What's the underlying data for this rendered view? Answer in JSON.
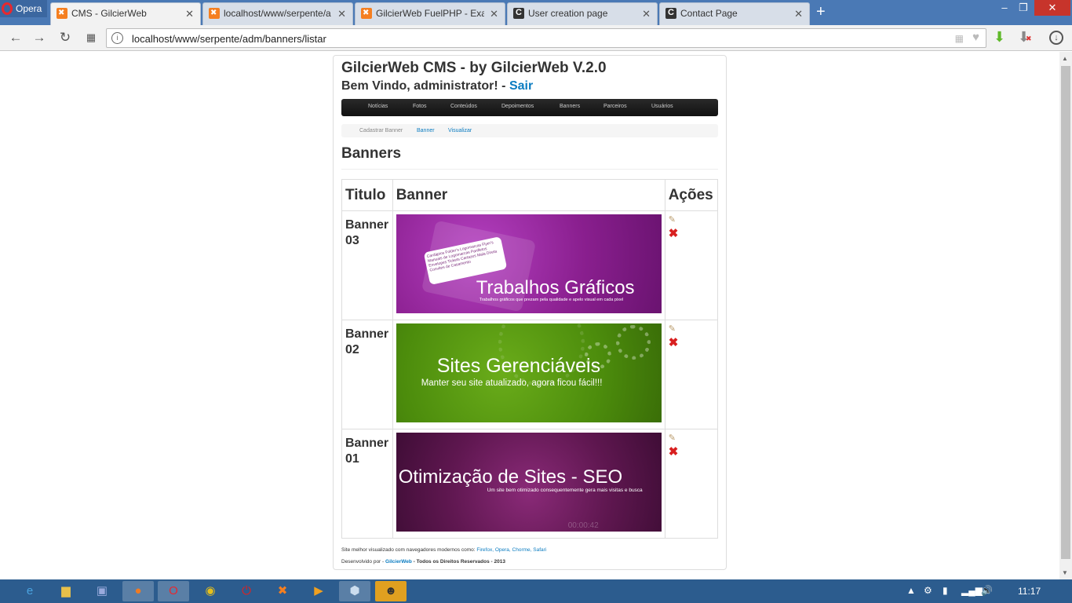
{
  "browser": {
    "menu_label": "Opera",
    "tabs": [
      {
        "label": "CMS - GilcierWeb",
        "icon": "xampp-icon",
        "active": true
      },
      {
        "label": "localhost/www/serpente/a",
        "icon": "xampp-icon",
        "active": false
      },
      {
        "label": "GilcierWeb FuelPHP - Exam",
        "icon": "xampp-icon",
        "active": false
      },
      {
        "label": "User creation page",
        "icon": "c-icon",
        "active": false
      },
      {
        "label": "Contact Page",
        "icon": "c-icon",
        "active": false
      }
    ],
    "address": "localhost/www/serpente/adm/banners/listar"
  },
  "page": {
    "site_title": "GilcierWeb CMS - by GilcierWeb V.2.0",
    "welcome_prefix": "Bem Vindo, administrator! -",
    "logout_label": "Sair",
    "nav": [
      "Notícias",
      "Fotos",
      "Conteúdos",
      "Depoimentos",
      "Banners",
      "Parceiros",
      "Usuários"
    ],
    "subnav": [
      "Cadastrar Banner",
      "Banner",
      "Visualizar"
    ],
    "heading": "Banners",
    "table": {
      "headers": [
        "Titulo",
        "Banner",
        "Ações"
      ],
      "rows": [
        {
          "title": "Banner 03",
          "banner_text": "Trabalhos Gráficos",
          "banner_sub": "Trabalhos gráficos que prezam pela qualidade e apelo visual em cada pixel",
          "bubble_text": "Cardápios  Folder's  Logomarcas  Flyer's  Manuais de Logomarcas  Panfletos  Envelopes  Tickets  Cartazes  Mala Direta  Convites de Casamento"
        },
        {
          "title": "Banner 02",
          "banner_text": "Sites Gerenciáveis",
          "banner_sub": "Manter seu site atualizado, agora ficou fácil!!!"
        },
        {
          "title": "Banner 01",
          "banner_text": "Otimização de Sites - SEO",
          "banner_sub": "Um site bem otimizado consequentemente gera mais visitas e busca",
          "watermark": "00:00:42"
        }
      ]
    },
    "footer": {
      "line1_prefix": "Site melhor visualizado com navegadores modernos como:",
      "browsers": [
        "Firefox,",
        "Opera,",
        "Chorme,",
        "Safari"
      ],
      "line2_prefix": "Desenvolvido por -",
      "dev_link": "GilcierWeb",
      "line2_suffix": "- Todos os Direitos Reservados - 2013"
    }
  },
  "taskbar": {
    "clock": "11:17"
  },
  "colors": {
    "link": "#0b7cc1",
    "navbar": "#1b1b1b",
    "tab_bar": "#4a79b5",
    "taskbar": "#2c5c8e"
  }
}
